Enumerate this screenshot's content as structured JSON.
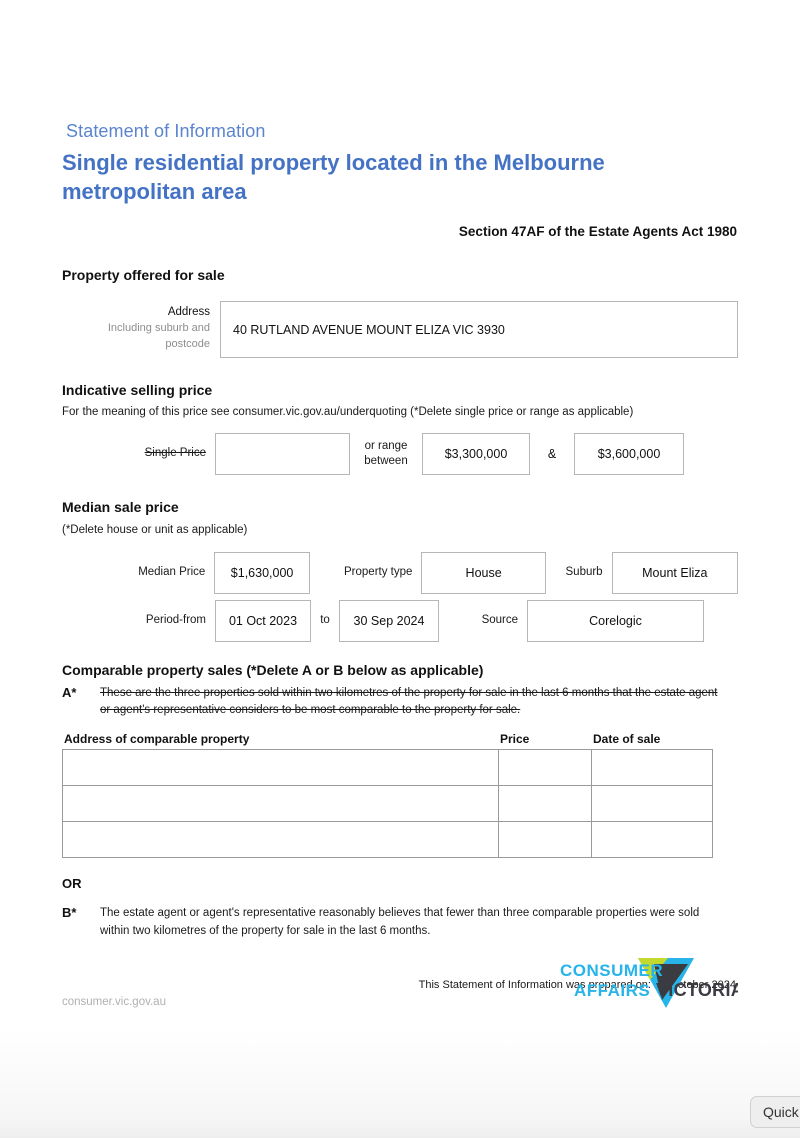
{
  "header": {
    "eyebrow": "Statement of Information",
    "title": "Single residential property located in the Melbourne metropolitan area",
    "act_reference": "Section 47AF of the Estate Agents Act 1980"
  },
  "property_offered": {
    "heading": "Property offered for sale",
    "address_label": "Address",
    "address_sublabel": "Including suburb and postcode",
    "address_value": "40 RUTLAND AVENUE MOUNT ELIZA VIC 3930"
  },
  "indicative_price": {
    "heading": "Indicative selling price",
    "subheading": "For the meaning of this price see consumer.vic.gov.au/underquoting (*Delete single price or range as applicable)",
    "single_price_label": "Single Price",
    "single_price_value": "",
    "or_range_label": "or range\nbetween",
    "range_low": "$3,300,000",
    "ampersand": "&",
    "range_high": "$3,600,000"
  },
  "median_sale_price": {
    "heading": "Median sale price",
    "subheading": "(*Delete house or unit as applicable)",
    "median_price_label": "Median Price",
    "median_price_value": "$1,630,000",
    "property_type_label": "Property type",
    "property_type_value": "House",
    "suburb_label": "Suburb",
    "suburb_value": "Mount Eliza",
    "period_from_label": "Period-from",
    "period_from_value": "01 Oct 2023",
    "to_label": "to",
    "period_to_value": "30 Sep 2024",
    "source_label": "Source",
    "source_value": "Corelogic"
  },
  "comparable_sales": {
    "heading": "Comparable property sales (*Delete A or B below as applicable)",
    "option_a_mark": "A*",
    "option_a_text": "These are the three properties sold within two kilometres of the property for sale in the last 6 months that the estate agent or agent's representative considers to be most comparable to the property for sale.",
    "columns": [
      "Address of comparable property",
      "Price",
      "Date of sale"
    ],
    "rows": [
      {
        "address": "",
        "price": "",
        "date_of_sale": ""
      },
      {
        "address": "",
        "price": "",
        "date_of_sale": ""
      },
      {
        "address": "",
        "price": "",
        "date_of_sale": ""
      }
    ],
    "or_label": "OR",
    "option_b_mark": "B*",
    "option_b_text": "The estate agent or agent's representative reasonably believes that fewer than three comparable properties were sold within two kilometres of the property for sale in the last 6 months."
  },
  "prepared_on": "This Statement of Information was prepared on: 28 October 2024",
  "footer": {
    "url": "consumer.vic.gov.au",
    "logo_line1": "CONSUMER",
    "logo_line2": "AFFAIRS",
    "logo_word": "VICTORIA"
  },
  "overlay": {
    "quick_button_label": "Quick"
  },
  "colors": {
    "heading_blue": "#4472c4",
    "eyebrow_blue": "#5b84d0",
    "logo_cyan": "#27b4e8",
    "logo_lime": "#c3d92e",
    "logo_dark": "#3b3b42",
    "box_border": "#b6b6b6"
  }
}
